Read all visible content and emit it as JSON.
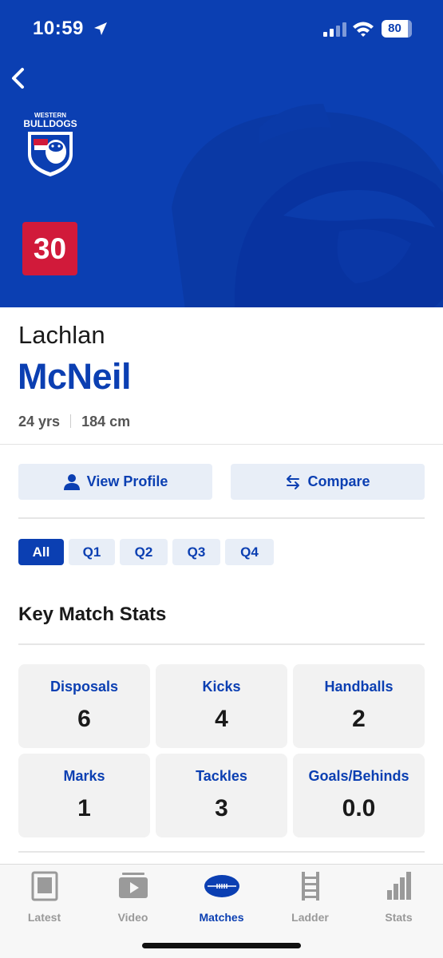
{
  "status_bar": {
    "time": "10:59",
    "battery": "80"
  },
  "header": {
    "club_logo_text_top": "WESTERN",
    "club_logo_text_main": "BULLDOGS",
    "jumper_number": "30",
    "back_icon": "chevron-left-icon",
    "colors": {
      "primary": "#0b3fb2",
      "badge": "#d11a3a"
    }
  },
  "player": {
    "first_name": "Lachlan",
    "last_name": "McNeil",
    "age": "24 yrs",
    "height": "184 cm"
  },
  "actions": {
    "view_profile": "View Profile",
    "compare": "Compare"
  },
  "quarters": {
    "selected": "All",
    "tabs": [
      "All",
      "Q1",
      "Q2",
      "Q3",
      "Q4"
    ]
  },
  "key_stats": {
    "title": "Key Match Stats",
    "items": [
      {
        "label": "Disposals",
        "value": "6"
      },
      {
        "label": "Kicks",
        "value": "4"
      },
      {
        "label": "Handballs",
        "value": "2"
      },
      {
        "label": "Marks",
        "value": "1"
      },
      {
        "label": "Tackles",
        "value": "3"
      },
      {
        "label": "Goals/Behinds",
        "value": "0.0"
      }
    ]
  },
  "tab_bar": {
    "active": "Matches",
    "items": [
      {
        "label": "Latest",
        "icon": "news-icon"
      },
      {
        "label": "Video",
        "icon": "video-icon"
      },
      {
        "label": "Matches",
        "icon": "football-icon"
      },
      {
        "label": "Ladder",
        "icon": "ladder-icon"
      },
      {
        "label": "Stats",
        "icon": "bar-chart-icon"
      }
    ]
  }
}
